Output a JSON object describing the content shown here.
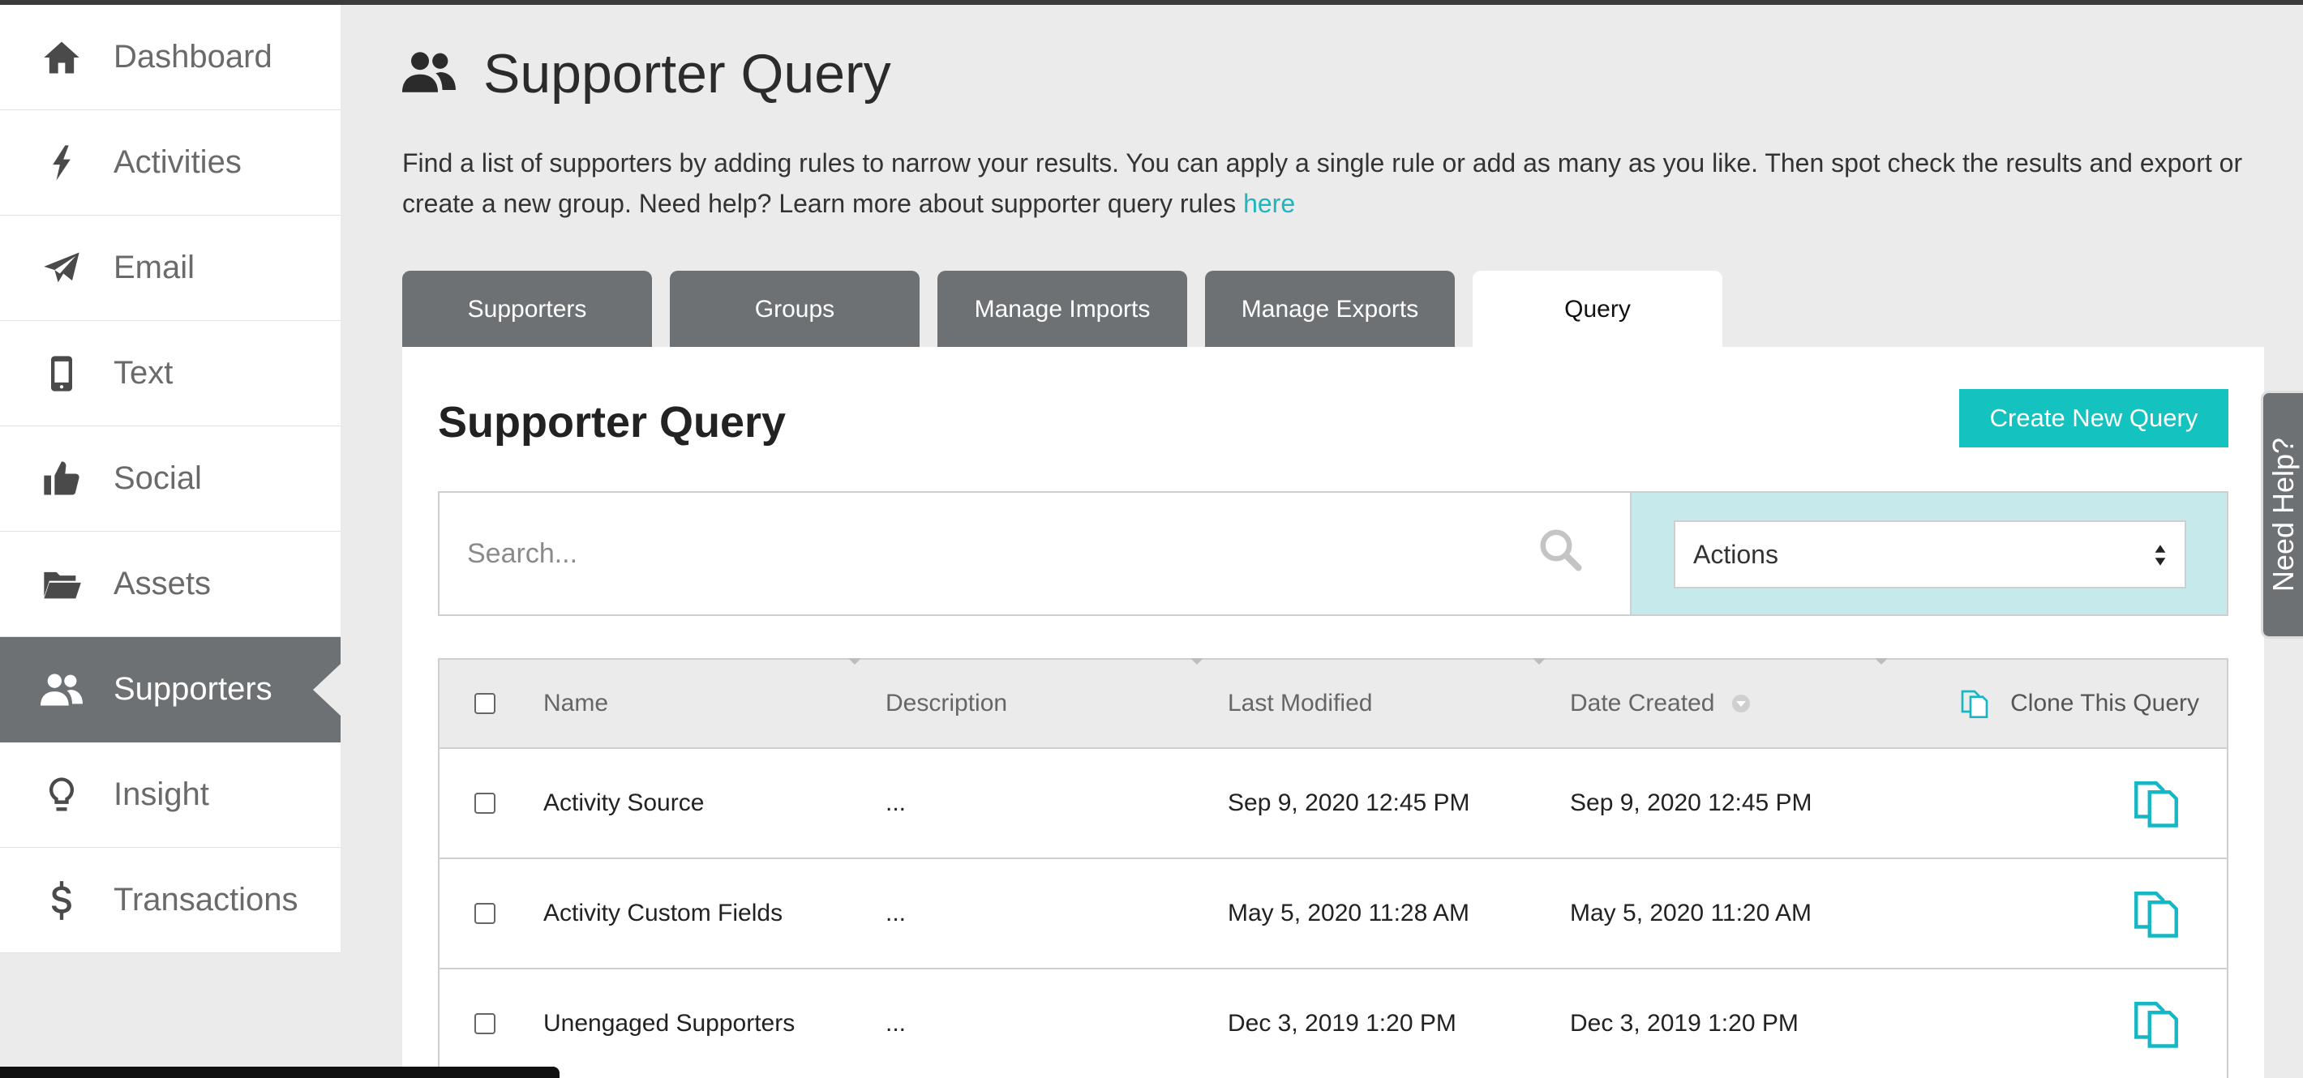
{
  "sidebar": {
    "items": [
      {
        "label": "Dashboard",
        "icon": "home-icon"
      },
      {
        "label": "Activities",
        "icon": "lightning-icon"
      },
      {
        "label": "Email",
        "icon": "paper-plane-icon"
      },
      {
        "label": "Text",
        "icon": "mobile-phone-icon"
      },
      {
        "label": "Social",
        "icon": "thumbs-up-icon"
      },
      {
        "label": "Assets",
        "icon": "folder-icon"
      },
      {
        "label": "Supporters",
        "icon": "users-icon",
        "active": true
      },
      {
        "label": "Insight",
        "icon": "lightbulb-icon"
      },
      {
        "label": "Transactions",
        "icon": "dollar-icon"
      }
    ]
  },
  "header": {
    "title": "Supporter Query",
    "intro": "Find a list of supporters by adding rules to narrow your results. You can apply a single rule or add as many as you like. Then spot check the results and export or create a new group. Need help? Learn more about supporter query rules ",
    "intro_link": "here"
  },
  "tabs": [
    {
      "label": "Supporters"
    },
    {
      "label": "Groups"
    },
    {
      "label": "Manage Imports"
    },
    {
      "label": "Manage Exports"
    },
    {
      "label": "Query",
      "active": true
    }
  ],
  "panel": {
    "title": "Supporter Query",
    "create_button": "Create New Query",
    "search_placeholder": "Search...",
    "actions_select": "Actions"
  },
  "table": {
    "columns": {
      "name": "Name",
      "description": "Description",
      "last_modified": "Last Modified",
      "date_created": "Date Created",
      "clone": "Clone This Query"
    },
    "rows": [
      {
        "name": "Activity Source",
        "description": "...",
        "last_modified": "Sep 9, 2020 12:45 PM",
        "date_created": "Sep 9, 2020 12:45 PM"
      },
      {
        "name": "Activity Custom Fields",
        "description": "...",
        "last_modified": "May 5, 2020 11:28 AM",
        "date_created": "May 5, 2020 11:20 AM"
      },
      {
        "name": "Unengaged Supporters",
        "description": "...",
        "last_modified": "Dec 3, 2019 1:20 PM",
        "date_created": "Dec 3, 2019 1:20 PM"
      }
    ]
  },
  "help_tab": "Need Help?",
  "colors": {
    "accent": "#14c2bf",
    "sidebar_active": "#6e7173",
    "actions_bg": "#c6eaeb",
    "link": "#1fb5bd"
  }
}
